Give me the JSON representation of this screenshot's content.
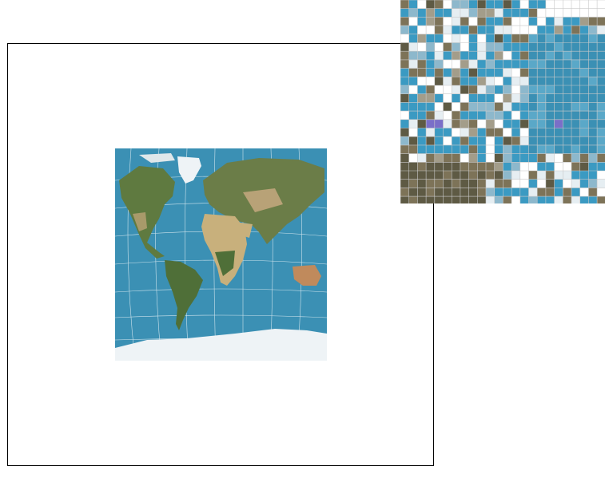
{
  "colors": {
    "ocean": "#3b90b4",
    "land_green": "#5f7a40",
    "desert": "#c8b07c",
    "ice": "#eef3f6",
    "frame": "#000000",
    "pixel_grid": "#c8c8c8"
  },
  "map": {
    "subject": "world-map",
    "projection_grid": "graticule-white"
  },
  "zoom_inset": {
    "subject": "magnified-pixel-grid",
    "grid": true
  }
}
